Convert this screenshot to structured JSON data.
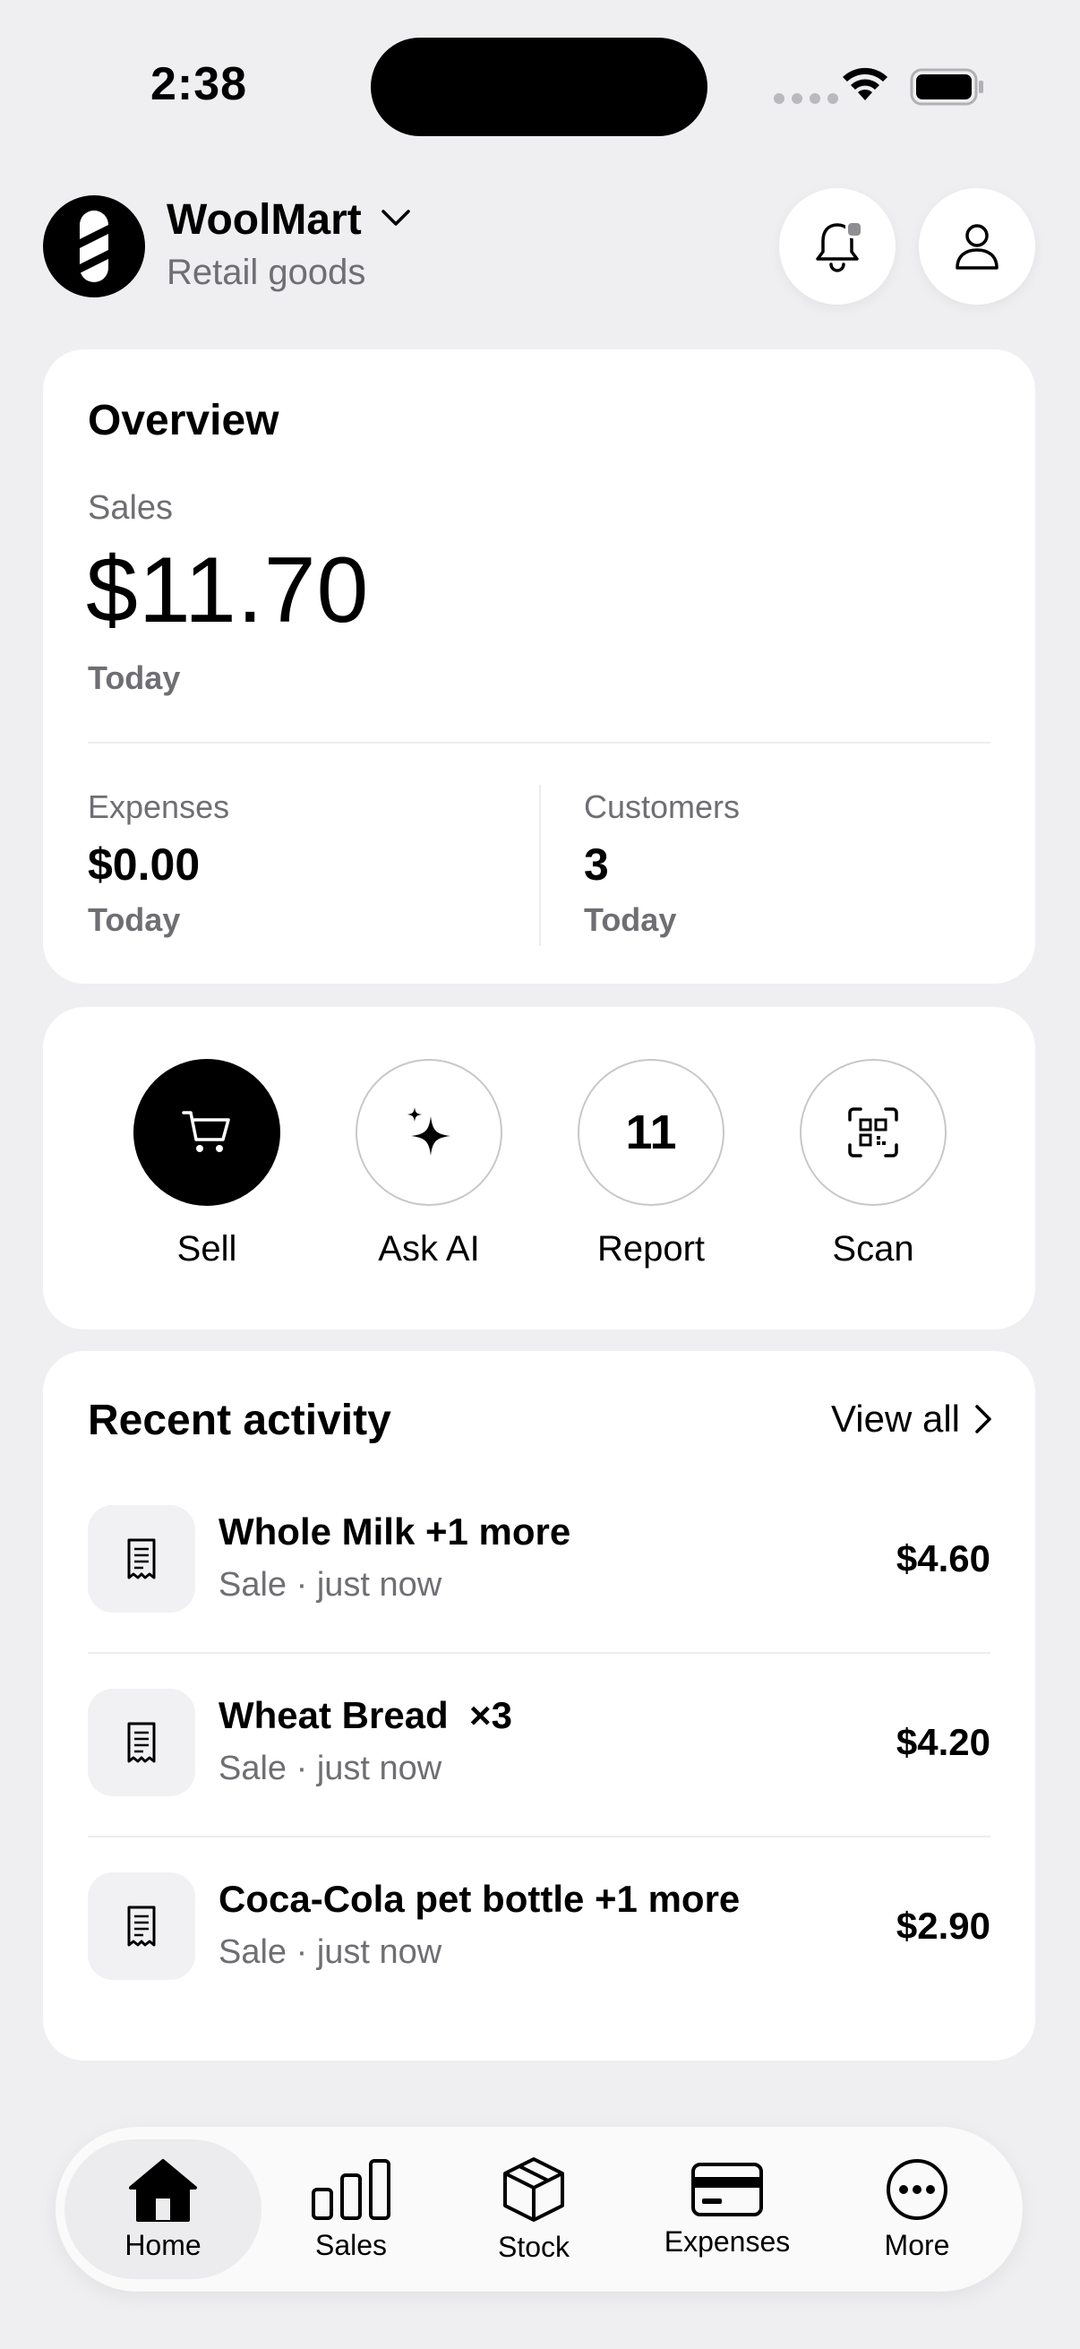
{
  "status_bar": {
    "time": "2:38"
  },
  "header": {
    "store_name": "WoolMart",
    "store_type": "Retail goods"
  },
  "overview": {
    "title": "Overview",
    "sales_label": "Sales",
    "sales_amount": "$11.70",
    "sales_period": "Today",
    "expenses": {
      "label": "Expenses",
      "value": "$0.00",
      "period": "Today"
    },
    "customers": {
      "label": "Customers",
      "value": "3",
      "period": "Today"
    }
  },
  "actions": [
    {
      "label": "Sell",
      "icon": "cart-icon"
    },
    {
      "label": "Ask AI",
      "icon": "sparkle-icon"
    },
    {
      "label": "Report",
      "icon": "report-number",
      "value": "11"
    },
    {
      "label": "Scan",
      "icon": "qr-scan-icon"
    }
  ],
  "recent": {
    "title": "Recent activity",
    "view_all": "View all",
    "items": [
      {
        "title": "Whole Milk +1 more",
        "subtitle": "Sale · just now",
        "amount": "$4.60"
      },
      {
        "title": "Wheat Bread  ×3",
        "subtitle": "Sale · just now",
        "amount": "$4.20"
      },
      {
        "title": "Coca-Cola pet bottle +1 more",
        "subtitle": "Sale · just now",
        "amount": "$2.90"
      }
    ]
  },
  "tabs": [
    {
      "label": "Home",
      "icon": "home-icon",
      "active": true
    },
    {
      "label": "Sales",
      "icon": "bar-chart-icon"
    },
    {
      "label": "Stock",
      "icon": "box-icon"
    },
    {
      "label": "Expenses",
      "icon": "card-icon"
    },
    {
      "label": "More",
      "icon": "more-icon"
    }
  ]
}
